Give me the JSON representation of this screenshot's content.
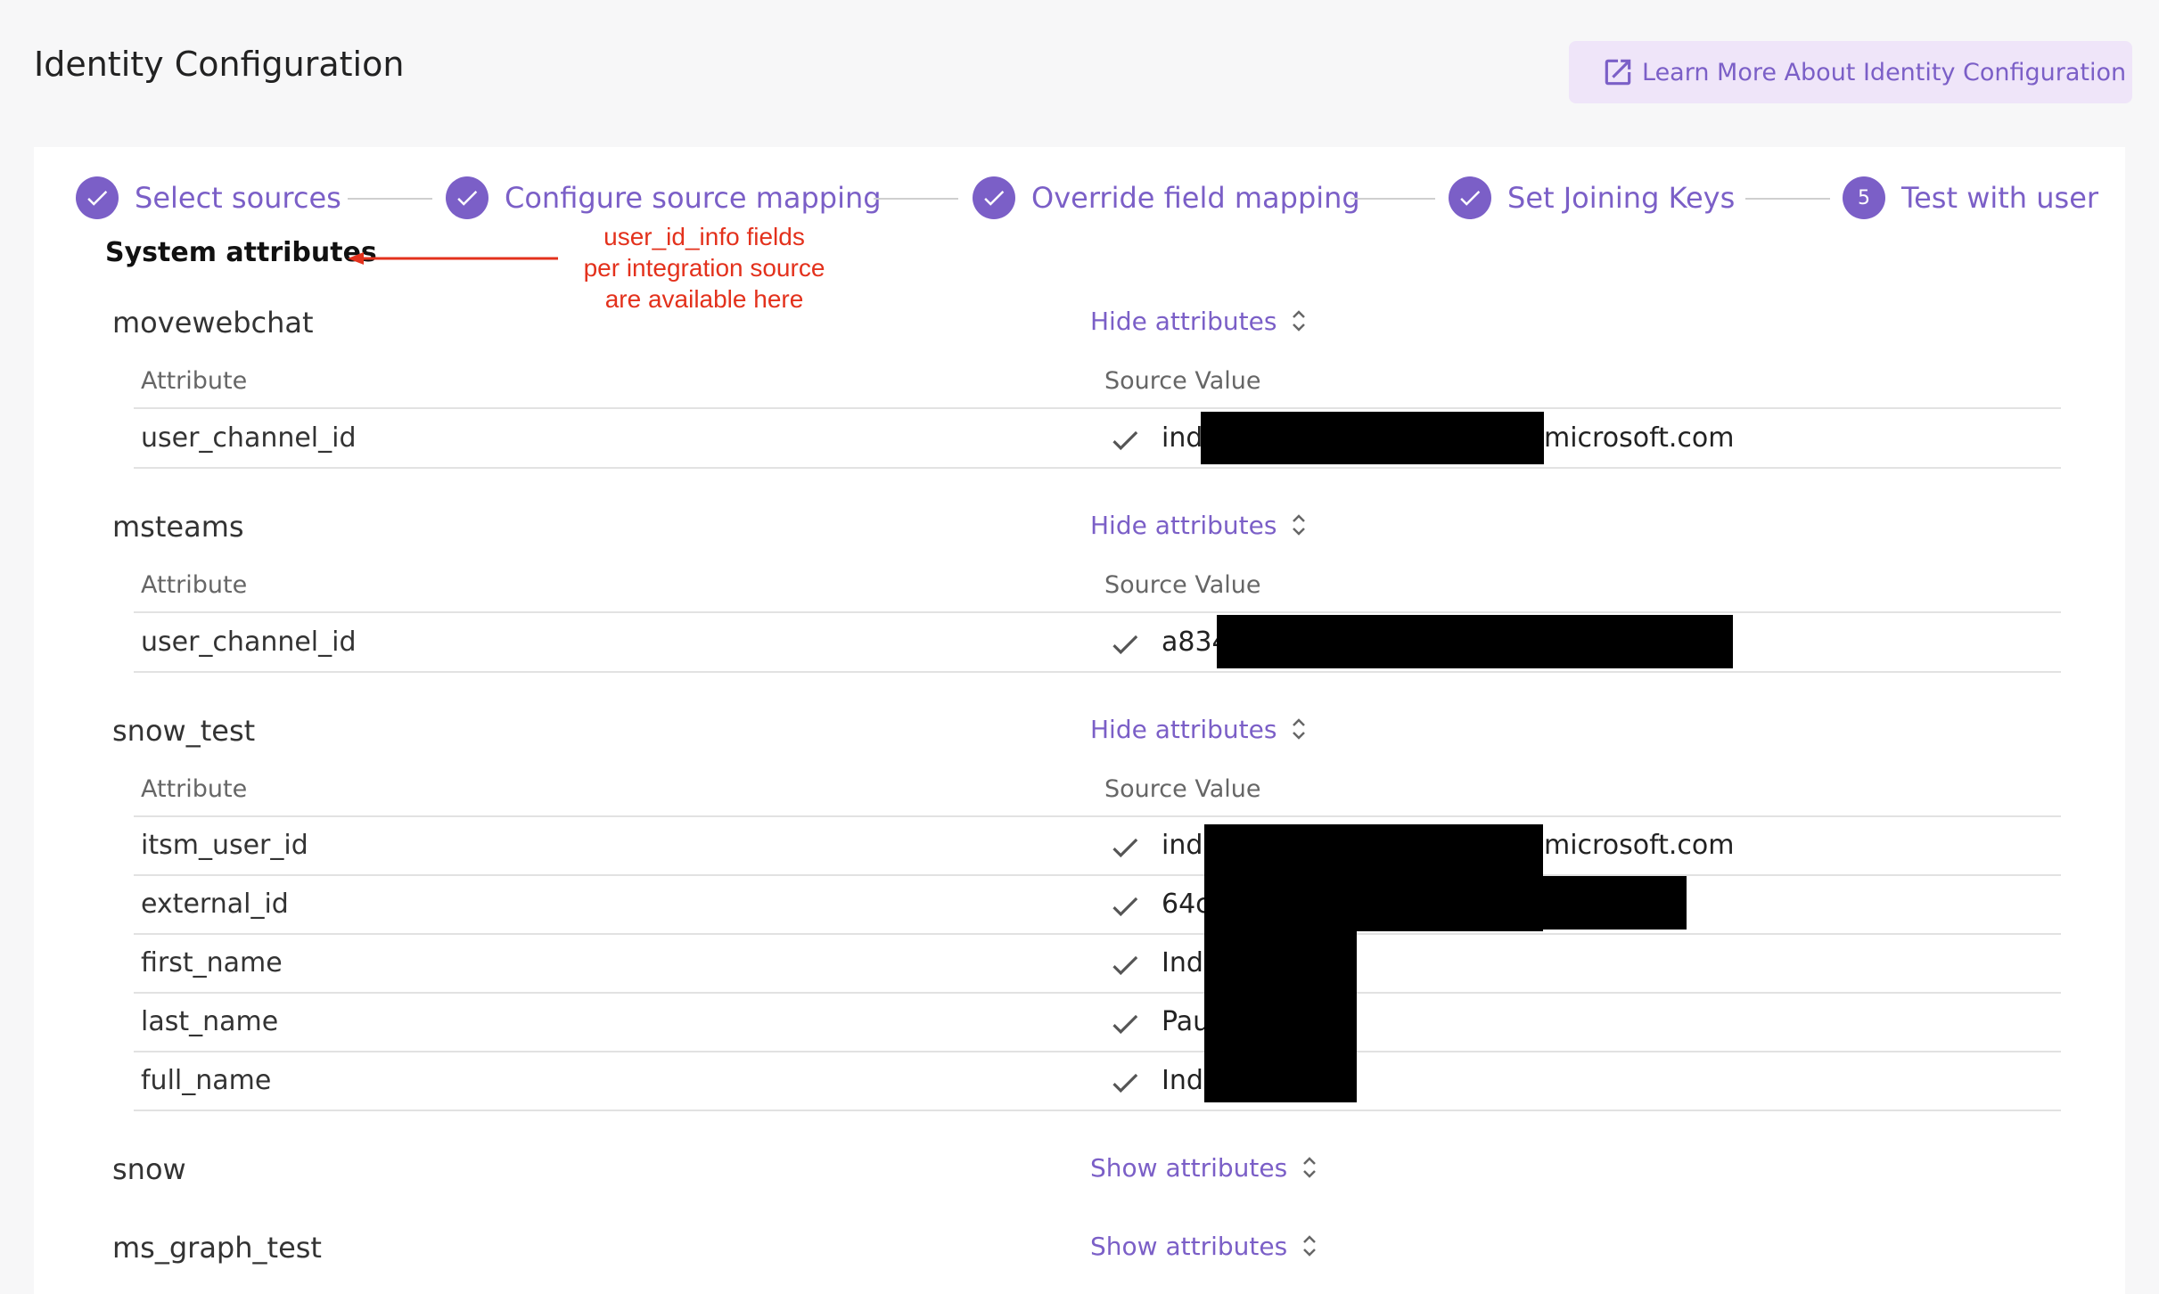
{
  "header": {
    "title": "Identity Configuration",
    "learn_more_label": "Learn More About Identity Configuration"
  },
  "stepper": {
    "steps": [
      {
        "label": "Select sources",
        "state": "done"
      },
      {
        "label": "Configure source mapping",
        "state": "done"
      },
      {
        "label": "Override field mapping",
        "state": "done"
      },
      {
        "label": "Set Joining Keys",
        "state": "done"
      },
      {
        "label": "Test with user",
        "state": "current",
        "number": "5"
      }
    ]
  },
  "section_title": "System attributes",
  "annotation": {
    "lines": [
      "user_id_info fields",
      "per integration source",
      "are available here"
    ],
    "color": "#e3311c"
  },
  "columns": {
    "attribute": "Attribute",
    "source_value": "Source Value"
  },
  "sources": [
    {
      "name": "movewebchat",
      "toggle_label": "Hide attributes",
      "rows": [
        {
          "attribute": "user_channel_id",
          "value_prefix": "ind",
          "value_suffix": "microsoft.com"
        }
      ]
    },
    {
      "name": "msteams",
      "toggle_label": "Hide attributes",
      "rows": [
        {
          "attribute": "user_channel_id",
          "value_prefix": "a834",
          "value_suffix": ""
        }
      ]
    },
    {
      "name": "snow_test",
      "toggle_label": "Hide attributes",
      "rows": [
        {
          "attribute": "itsm_user_id",
          "value_prefix": "ind",
          "value_suffix": "microsoft.com"
        },
        {
          "attribute": "external_id",
          "value_prefix": "64c",
          "value_suffix": ""
        },
        {
          "attribute": "first_name",
          "value_prefix": "Ind",
          "value_suffix": ""
        },
        {
          "attribute": "last_name",
          "value_prefix": "Pau",
          "value_suffix": ""
        },
        {
          "attribute": "full_name",
          "value_prefix": "Ind",
          "value_suffix": ""
        }
      ]
    },
    {
      "name": "snow",
      "toggle_label": "Show attributes"
    },
    {
      "name": "ms_graph_test",
      "toggle_label": "Show attributes"
    }
  ],
  "colors": {
    "accent": "#7b5fc7",
    "accent_bg": "#efe5f9",
    "annotation": "#e3311c",
    "redaction": "#000000"
  }
}
